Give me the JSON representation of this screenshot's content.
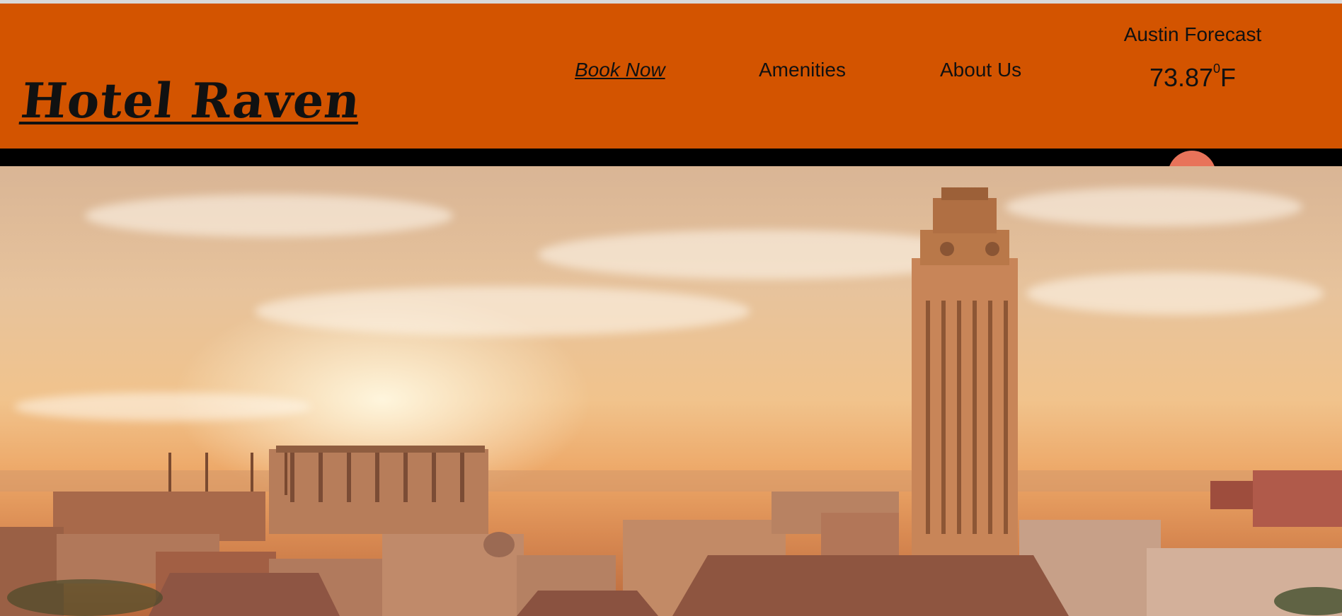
{
  "site": {
    "logo": "Hotel Raven"
  },
  "nav": {
    "items": [
      {
        "label": "Book Now"
      },
      {
        "label": "Amenities"
      },
      {
        "label": "About Us"
      }
    ]
  },
  "forecast": {
    "title": "Austin Forecast",
    "temp_value": "73.87",
    "temp_degree": "0",
    "temp_unit": "F"
  },
  "colors": {
    "header_bg": "#d35400",
    "bar": "#000000",
    "accent_bubble": "#e8735a"
  },
  "hero": {
    "image": "Austin skyline at sunset with clock tower"
  }
}
